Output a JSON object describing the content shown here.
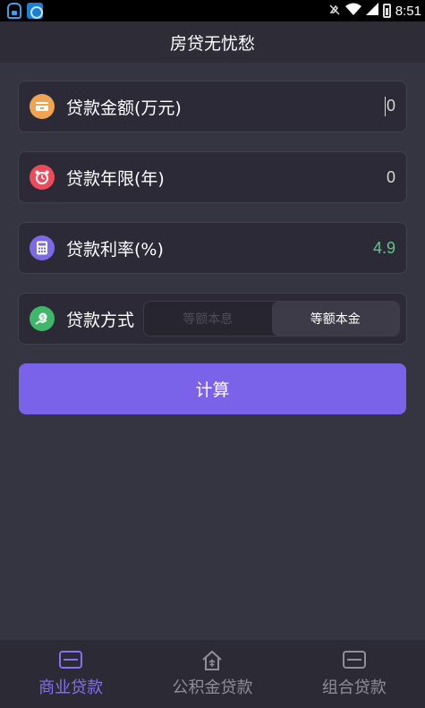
{
  "status_bar": {
    "time": "8:51",
    "icons": [
      "app-notification-icon",
      "app-notification-icon-2",
      "mute-icon",
      "wifi-icon",
      "signal-icon",
      "battery-icon"
    ]
  },
  "header": {
    "title": "房贷无忧愁"
  },
  "form": {
    "amount": {
      "label": "贷款金额(万元)",
      "value": "0",
      "icon": "wallet-icon",
      "icon_color": "#f0a350"
    },
    "years": {
      "label": "贷款年限(年)",
      "value": "0",
      "icon": "alarm-clock-icon",
      "icon_color": "#ee4b5a"
    },
    "rate": {
      "label": "贷款利率(%)",
      "value": "4.9",
      "icon": "calculator-icon",
      "icon_color": "#7b69e6",
      "value_color": "#5fc886"
    },
    "method": {
      "label": "贷款方式",
      "icon": "money-hand-icon",
      "icon_color": "#3fb66a",
      "options": [
        "等额本息",
        "等额本金"
      ],
      "selected": "等额本金"
    }
  },
  "calculate_label": "计算",
  "bottom_nav": {
    "items": [
      {
        "label": "商业贷款",
        "icon": "card-icon",
        "active": true
      },
      {
        "label": "公积金贷款",
        "icon": "house-icon",
        "active": false
      },
      {
        "label": "组合贷款",
        "icon": "card-icon",
        "active": false
      }
    ]
  },
  "colors": {
    "background": "#353441",
    "accent": "#7a63e8",
    "nav_active": "#8670f0"
  }
}
